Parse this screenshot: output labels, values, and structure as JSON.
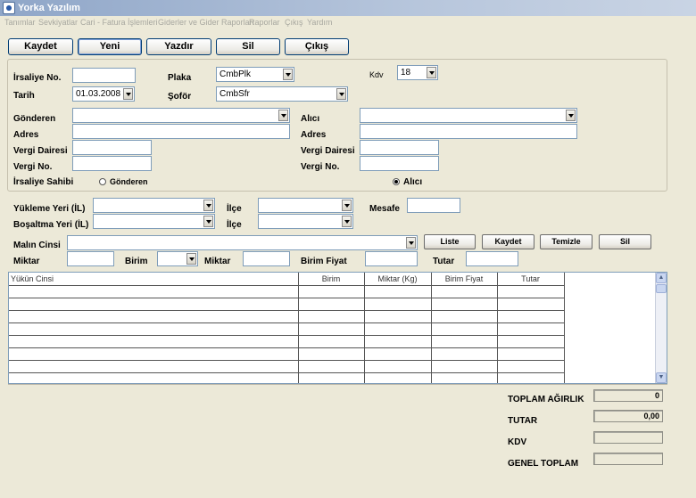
{
  "window": {
    "title": "Yorka Yazılım"
  },
  "menu": [
    "Tanımlar",
    "Sevkiyatlar",
    "Cari - Fatura İşlemleri",
    "Giderler ve Gider Raporları",
    "Raporlar",
    "Çıkış",
    "Yardım"
  ],
  "toolbar": {
    "save": "Kaydet",
    "new": "Yeni",
    "print": "Yazdır",
    "delete": "Sil",
    "exit": "Çıkış"
  },
  "form": {
    "irsaliye_no_label": "İrsaliye No.",
    "tarih_label": "Tarih",
    "tarih_value": "01.03.2008",
    "plaka_label": "Plaka",
    "plaka_value": "CmbPlk",
    "sofor_label": "Şoför",
    "sofor_value": "CmbSfr",
    "kdv_label": "Kdv",
    "kdv_value": "18",
    "gonderen_label": "Gönderen",
    "alici_label": "Alıcı",
    "adres_label": "Adres",
    "vergi_dairesi_label": "Vergi Dairesi",
    "vergi_no_label": "Vergi No.",
    "irsaliye_sahibi_label": "İrsaliye Sahibi",
    "sahibi_gonderen": "Gönderen",
    "sahibi_alici": "Alıcı",
    "sahibi_selected": "Alıcı"
  },
  "route": {
    "yukleme_label": "Yükleme Yeri (İL)",
    "bosaltma_label": "Boşaltma Yeri (İL)",
    "ilce_label": "İlçe",
    "mesafe_label": "Mesafe"
  },
  "item": {
    "malin_cinsi_label": "Malın Cinsi",
    "miktar_label": "Miktar",
    "birim_label": "Birim",
    "miktar2_label": "Miktar",
    "birim_fiyat_label": "Birim Fiyat",
    "tutar_label": "Tutar",
    "buttons": {
      "list": "Liste",
      "save": "Kaydet",
      "clear": "Temizle",
      "delete": "Sil"
    }
  },
  "grid": {
    "columns": [
      "Yükün Cinsi",
      "Birim",
      "Miktar (Kg)",
      "Birim Fiyat",
      "Tutar"
    ],
    "rows": [
      [
        "",
        "",
        "",
        "",
        ""
      ],
      [
        "",
        "",
        "",
        "",
        ""
      ],
      [
        "",
        "",
        "",
        "",
        ""
      ],
      [
        "",
        "",
        "",
        "",
        ""
      ],
      [
        "",
        "",
        "",
        "",
        ""
      ],
      [
        "",
        "",
        "",
        "",
        ""
      ],
      [
        "",
        "",
        "",
        "",
        ""
      ],
      [
        "",
        "",
        "",
        "",
        ""
      ]
    ]
  },
  "summary": {
    "toplam_agirlik_label": "TOPLAM AĞIRLIK",
    "toplam_agirlik_value": "0",
    "tutar_label": "TUTAR",
    "tutar_value": "0,00",
    "kdv_label": "KDV",
    "kdv_value": "",
    "genel_toplam_label": "GENEL TOPLAM",
    "genel_toplam_value": ""
  }
}
